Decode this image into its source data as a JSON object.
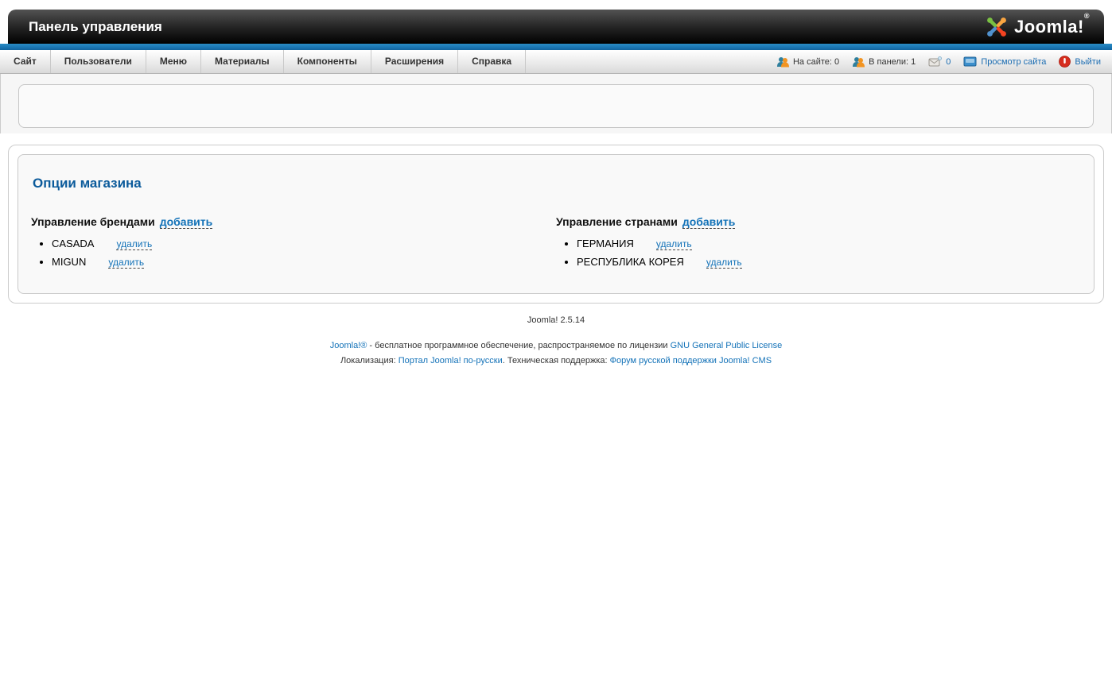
{
  "header": {
    "title": "Панель управления",
    "logo_text": "Joomla!",
    "logo_reg": "®"
  },
  "menubar": {
    "items": [
      {
        "label": "Сайт"
      },
      {
        "label": "Пользователи"
      },
      {
        "label": "Меню"
      },
      {
        "label": "Материалы"
      },
      {
        "label": "Компоненты"
      },
      {
        "label": "Расширения"
      },
      {
        "label": "Справка"
      }
    ]
  },
  "statusbar": {
    "on_site": "На сайте: 0",
    "in_panel": "В панели: 1",
    "messages_count": "0",
    "preview_label": "Просмотр сайта",
    "logout_label": "Выйти"
  },
  "shop": {
    "title": "Опции магазина",
    "brands": {
      "title": "Управление брендами",
      "add_label": "добавить",
      "items": [
        {
          "name": "CASADA",
          "delete_label": "удалить"
        },
        {
          "name": "MIGUN",
          "delete_label": "удалить"
        }
      ]
    },
    "countries": {
      "title": "Управление странами",
      "add_label": "добавить",
      "items": [
        {
          "name": "ГЕРМАНИЯ",
          "delete_label": "удалить"
        },
        {
          "name": "РЕСПУБЛИКА КОРЕЯ",
          "delete_label": "удалить"
        }
      ]
    }
  },
  "footer": {
    "version": "Joomla! 2.5.14",
    "license_line": {
      "joomla_link": "Joomla!®",
      "text": " - бесплатное программное обеспечение, распространяемое по лицензии ",
      "gpl_link": "GNU General Public License"
    },
    "support_line": {
      "loc_label": "Локализация: ",
      "loc_link": "Портал Joomla! по-русски",
      "mid_text": ". Техническая поддержка: ",
      "support_link": "Форум русской поддержки Joomla! CMS"
    }
  },
  "colors": {
    "accent_blue": "#1372b8",
    "heading_blue": "#0c5b9b",
    "strip_blue": "#1a77b4",
    "header_dark": "#000000",
    "logout_red": "#d62d1e"
  }
}
